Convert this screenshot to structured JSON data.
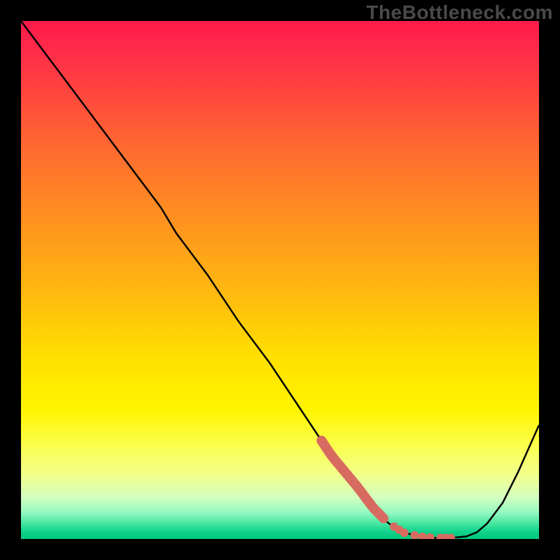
{
  "watermark": "TheBottleneck.com",
  "chart_data": {
    "type": "line",
    "title": "",
    "xlabel": "",
    "ylabel": "",
    "xlim": [
      0,
      100
    ],
    "ylim": [
      0,
      100
    ],
    "gradient_stops": [
      {
        "pct": 0,
        "color": "#ff1a4a"
      },
      {
        "pct": 5,
        "color": "#ff2a4a"
      },
      {
        "pct": 12,
        "color": "#ff4040"
      },
      {
        "pct": 25,
        "color": "#ff6b30"
      },
      {
        "pct": 38,
        "color": "#ff9020"
      },
      {
        "pct": 52,
        "color": "#ffb810"
      },
      {
        "pct": 65,
        "color": "#ffe000"
      },
      {
        "pct": 75,
        "color": "#fff400"
      },
      {
        "pct": 82,
        "color": "#fbff4d"
      },
      {
        "pct": 88,
        "color": "#f0ff90"
      },
      {
        "pct": 92,
        "color": "#d3ffc0"
      },
      {
        "pct": 95,
        "color": "#91f8c0"
      },
      {
        "pct": 97,
        "color": "#46e6a0"
      },
      {
        "pct": 98.5,
        "color": "#13d38e"
      },
      {
        "pct": 100,
        "color": "#00c87a"
      }
    ],
    "series": [
      {
        "name": "bottleneck-curve",
        "color": "#000000",
        "x": [
          0,
          6,
          12,
          18,
          24,
          27,
          30,
          36,
          42,
          48,
          54,
          60,
          65,
          68,
          71,
          74,
          77,
          80,
          83,
          86,
          88,
          90,
          93,
          96,
          100
        ],
        "y": [
          100,
          92,
          84,
          76,
          68,
          64,
          59,
          51,
          42,
          34,
          25,
          16,
          10,
          6,
          3,
          1.2,
          0.5,
          0.2,
          0.2,
          0.5,
          1.3,
          3,
          7,
          13,
          22
        ]
      }
    ],
    "dotted_overlay": {
      "name": "highlighted-range",
      "color": "#d86b60",
      "segments": [
        {
          "x": [
            58,
            70
          ],
          "style": "thick"
        },
        {
          "x": [
            72,
            74
          ],
          "style": "dots"
        },
        {
          "x": [
            76,
            79
          ],
          "style": "dots"
        },
        {
          "x": [
            81,
            83
          ],
          "style": "dots"
        }
      ]
    }
  }
}
